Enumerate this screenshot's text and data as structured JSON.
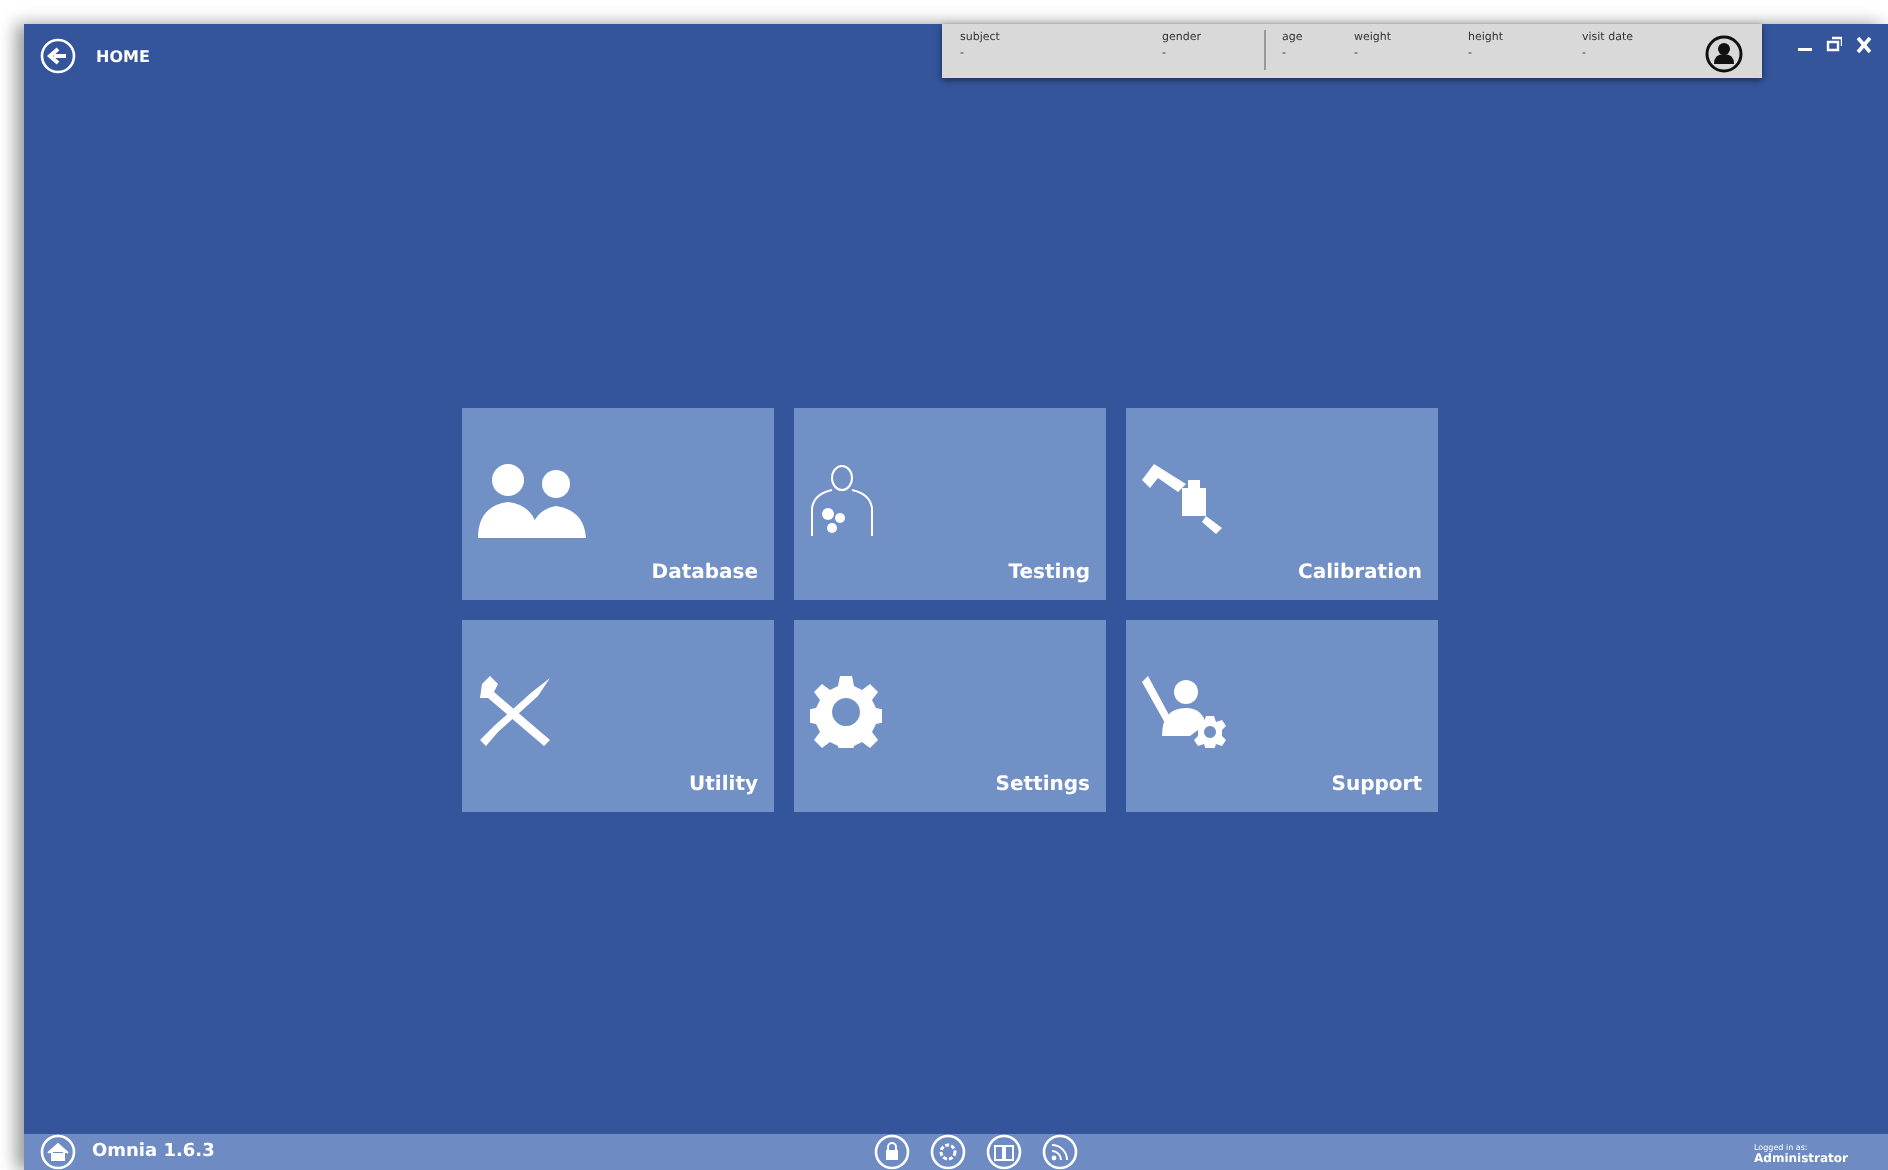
{
  "header": {
    "back_title": "HOME"
  },
  "patient": {
    "identity": [
      {
        "label": "subject",
        "value": "-"
      },
      {
        "label": "gender",
        "value": "-"
      }
    ],
    "measures": [
      {
        "label": "age",
        "value": "-"
      },
      {
        "label": "weight",
        "value": "-"
      },
      {
        "label": "height",
        "value": "-"
      },
      {
        "label": "visit date",
        "value": "-"
      }
    ]
  },
  "tiles": [
    {
      "label": "Database",
      "kind": "people"
    },
    {
      "label": "Testing",
      "kind": "body"
    },
    {
      "label": "Calibration",
      "kind": "calibration"
    },
    {
      "label": "Utility",
      "kind": "tools"
    },
    {
      "label": "Settings",
      "kind": "gear"
    },
    {
      "label": "Support",
      "kind": "support"
    }
  ],
  "footer": {
    "app_version": "Omnia 1.6.3",
    "logged_in_label": "Logged in as:",
    "user": "Administrator"
  }
}
